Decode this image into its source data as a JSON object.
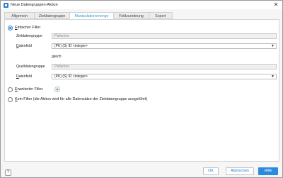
{
  "window": {
    "title": "Neue Datengruppen-Aktion",
    "close_glyph": "✕",
    "accent_color": "#2a8ae0"
  },
  "tabs": [
    {
      "label": "Allgemein",
      "active": false
    },
    {
      "label": "Zieldatengruppe",
      "active": false
    },
    {
      "label": "Manipulationsmenge",
      "active": true
    },
    {
      "label": "Feldzuordnung",
      "active": false
    },
    {
      "label": "Expert",
      "active": false
    }
  ],
  "filter": {
    "simple": {
      "label_first": "E",
      "label_rest": "infacher Filter",
      "checked": true
    },
    "target_group_label": "Zieldatengruppe",
    "target_group_value": "Patienten",
    "field_label_first": "D",
    "field_label_rest": "atenfeld",
    "field_value": "(PK) (S) ID <integer>",
    "equals_text": "gleich",
    "source_group_label": "Quelldatengruppe",
    "source_group_value": "Patienten",
    "source_field_label_first": "D",
    "source_field_label_rest": "atenfeld",
    "source_field_value": "(PK) (S) ID <integer>",
    "extended": {
      "label_first": "E",
      "label_rest": "rweiterter Filter",
      "checked": false
    },
    "none": {
      "label_first": "K",
      "label_rest": "ein Filter (die Aktion wird für alle Datensätze der Zieldatengruppe ausgeführt)",
      "checked": false
    },
    "dropdown_arrow": "▼"
  },
  "footer": {
    "help_glyph": "?",
    "ok_label": "OK",
    "cancel_label": "Abbrechen",
    "help_label": "Hilfe"
  }
}
